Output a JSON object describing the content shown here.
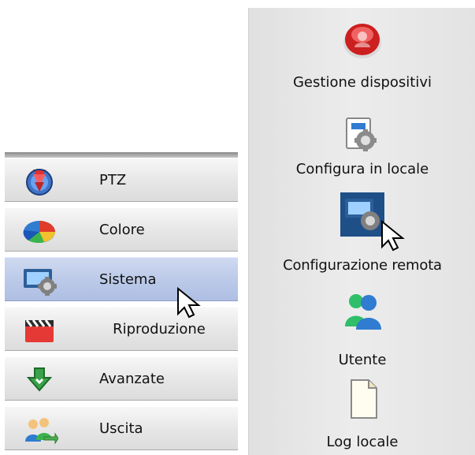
{
  "left_menu": {
    "items": [
      {
        "label": "PTZ",
        "icon": "ptz-icon"
      },
      {
        "label": "Colore",
        "icon": "color-pie-icon"
      },
      {
        "label": "Sistema",
        "icon": "settings-screen-icon",
        "active": true
      },
      {
        "label": "Riproduzione",
        "icon": "clapperboard-icon"
      },
      {
        "label": "Avanzate",
        "icon": "down-arrow-icon"
      },
      {
        "label": "Uscita",
        "icon": "users-exit-icon"
      }
    ]
  },
  "right_panel": {
    "items": [
      {
        "label": "Gestione dispositivi",
        "icon": "red-device-icon"
      },
      {
        "label": "Configura in locale",
        "icon": "local-config-icon"
      },
      {
        "label": "Configurazione remota",
        "icon": "remote-config-icon"
      },
      {
        "label": "Utente",
        "icon": "users-icon"
      },
      {
        "label": "Log locale",
        "icon": "document-icon"
      }
    ]
  },
  "colors": {
    "active_blue": "#b9c8e8",
    "panel_gray": "#e6e6e6"
  }
}
